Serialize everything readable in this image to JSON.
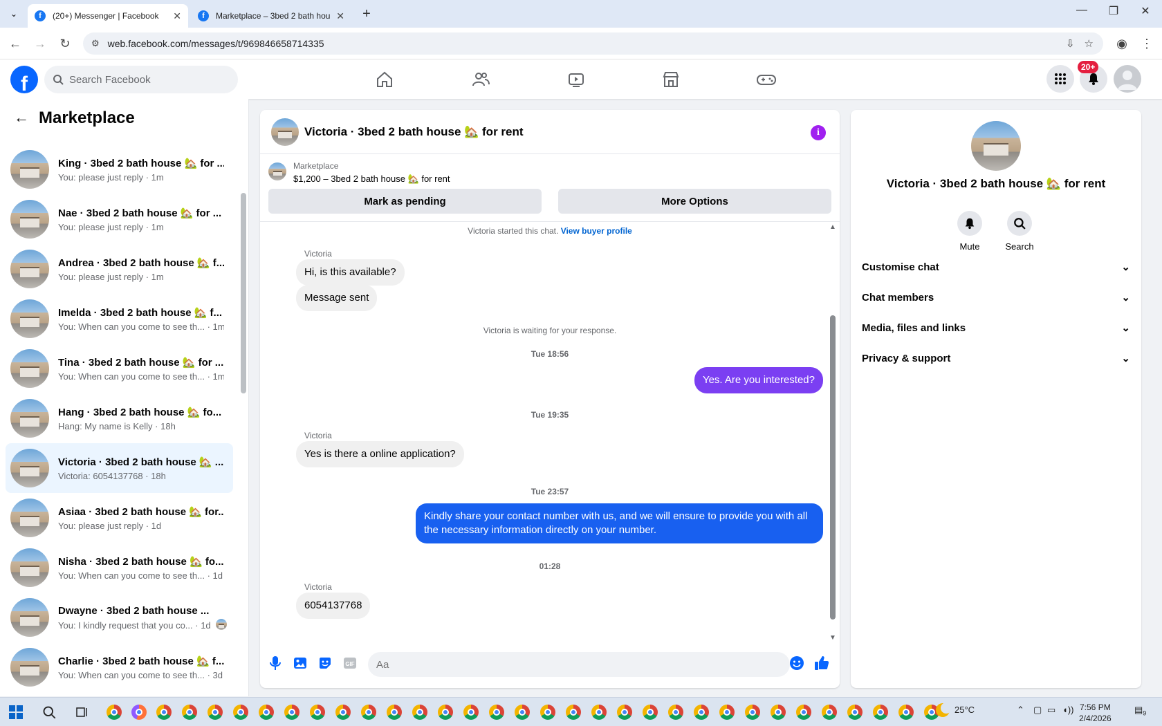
{
  "browser": {
    "tabs": [
      {
        "title": "(20+) Messenger | Facebook",
        "active": true
      },
      {
        "title": "Marketplace – 3bed 2 bath hou",
        "active": false
      }
    ],
    "url": "web.facebook.com/messages/t/969846658714335"
  },
  "fb": {
    "search_placeholder": "Search Facebook",
    "notification_badge": "20+"
  },
  "sidebar": {
    "title": "Marketplace",
    "conversations": [
      {
        "name": "King · 3bed 2 bath house 🏡 for ...",
        "preview": "You: please just reply · 1m"
      },
      {
        "name": "Nae · 3bed 2 bath house 🏡 for ...",
        "preview": "You: please just reply · 1m"
      },
      {
        "name": "Andrea · 3bed 2 bath house 🏡 f...",
        "preview": "You: please just reply · 1m"
      },
      {
        "name": "Imelda · 3bed 2 bath house 🏡 f...",
        "preview": "You: When can you come to see th... · 1m"
      },
      {
        "name": "Tina · 3bed 2 bath house 🏡 for ...",
        "preview": "You: When can you come to see th... · 1m"
      },
      {
        "name": "Hang · 3bed 2 bath house 🏡 fo...",
        "preview": "Hang: My name is Kelly · 18h"
      },
      {
        "name": "Victoria · 3bed 2 bath house 🏡 ...",
        "preview": "Victoria: 6054137768 · 18h",
        "active": true
      },
      {
        "name": "Asiaa · 3bed 2 bath house 🏡 for...",
        "preview": "You: please just reply · 1d"
      },
      {
        "name": "Nisha · 3bed 2 bath house 🏡 fo...",
        "preview": "You: When can you come to see th... · 1d"
      },
      {
        "name": "Dwayne · 3bed 2 bath house ...",
        "preview": "You: I kindly request that you co... · 1d",
        "seen": true
      },
      {
        "name": "Charlie · 3bed 2 bath house 🏡 f...",
        "preview": "You: When can you come to see th... · 3d"
      }
    ]
  },
  "chat": {
    "title": "Victoria · 3bed 2 bath house 🏡 for rent",
    "marketplace_label": "Marketplace",
    "listing": "$1,200 – 3bed 2 bath house 🏡 for rent",
    "mark_pending": "Mark as pending",
    "more_options": "More Options",
    "started": "Victoria started this chat.",
    "view_buyer": "View buyer profile",
    "waiting": "Victoria is waiting for your response.",
    "sender_name": "Victoria",
    "messages": {
      "m1": "Hi, is this available?",
      "m2": "Message sent",
      "ts1": "Tue 18:56",
      "m3": "Yes. Are you interested?",
      "ts2": "Tue 19:35",
      "m4": "Yes is there a online application?",
      "ts3": "Tue 23:57",
      "m5": "Kindly share your contact number with us, and we will ensure to provide you with all the necessary information directly on your number.",
      "ts4": "01:28",
      "m6": "6054137768"
    },
    "composer_placeholder": "Aa"
  },
  "info_panel": {
    "title": "Victoria · 3bed 2 bath house 🏡 for rent",
    "mute": "Mute",
    "search": "Search",
    "sections": [
      "Customise chat",
      "Chat members",
      "Media, files and links",
      "Privacy & support"
    ]
  },
  "taskbar": {
    "weather": "25°C",
    "time": "7:56 PM",
    "date": "2/4/2026",
    "notif_count": "9"
  },
  "colors": {
    "fb_blue": "#0866ff",
    "outgoing_purple": "#7b3ff2",
    "outgoing_blue": "#1860f0",
    "active_conv": "#ebf5ff"
  }
}
